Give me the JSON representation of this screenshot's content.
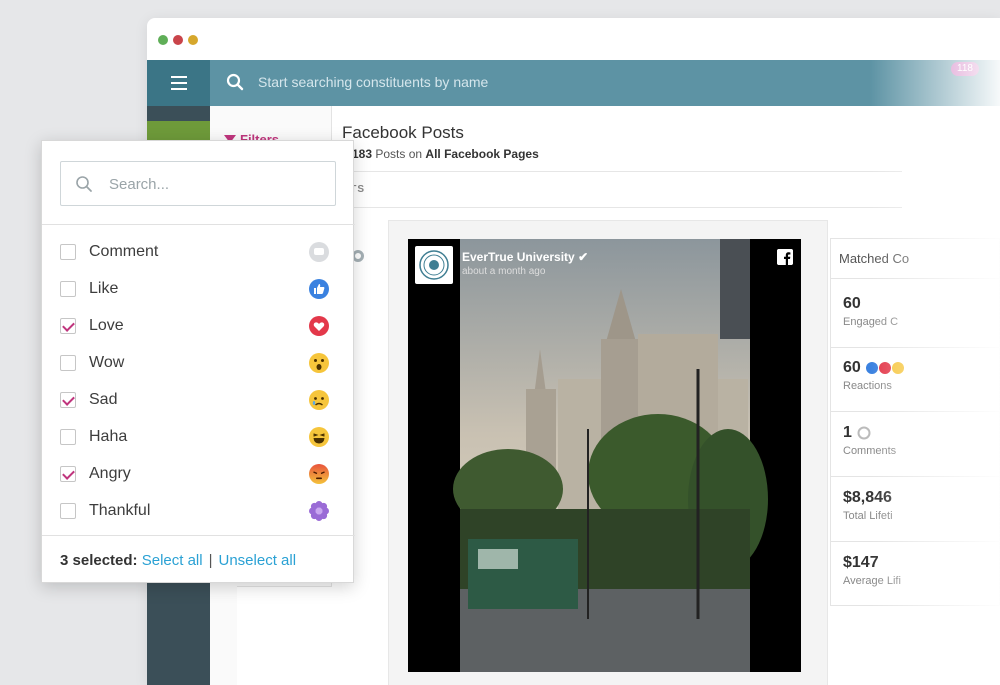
{
  "topbar": {
    "search_placeholder": "Start searching constituents by name",
    "badge": "118"
  },
  "filters": {
    "label": "Filters"
  },
  "main": {
    "title": "Facebook Posts",
    "subtitle_count": "2,183",
    "subtitle_mid": " Posts on ",
    "subtitle_scope": "All Facebook Pages",
    "tab_fragment": "NTS"
  },
  "post": {
    "author": "EverTrue University",
    "time": "about a month ago"
  },
  "stats": {
    "header": "Matched Co",
    "items": [
      {
        "value": "60",
        "label": "Engaged C"
      },
      {
        "value": "60",
        "label": "Reactions"
      },
      {
        "value": "1",
        "label": "Comments"
      },
      {
        "value": "$8,846",
        "label": "Total Lifeti"
      },
      {
        "value": "$147",
        "label": "Average Lifi"
      }
    ]
  },
  "dropdown": {
    "search_placeholder": "Search...",
    "options": [
      {
        "label": "Comment",
        "checked": false,
        "icon": "comment-icon"
      },
      {
        "label": "Like",
        "checked": false,
        "icon": "like-icon"
      },
      {
        "label": "Love",
        "checked": true,
        "icon": "love-icon"
      },
      {
        "label": "Wow",
        "checked": false,
        "icon": "wow-icon"
      },
      {
        "label": "Sad",
        "checked": true,
        "icon": "sad-icon"
      },
      {
        "label": "Haha",
        "checked": false,
        "icon": "haha-icon"
      },
      {
        "label": "Angry",
        "checked": true,
        "icon": "angry-icon"
      },
      {
        "label": "Thankful",
        "checked": false,
        "icon": "thankful-icon"
      }
    ],
    "selected_text": "3 selected:",
    "select_all": "Select all",
    "separator": "|",
    "unselect_all": "Unselect all"
  },
  "colors": {
    "topbar": "#5d93a4",
    "menu": "#3b7586",
    "accent_pink": "#c0357d",
    "link_blue": "#2aa1d4"
  }
}
